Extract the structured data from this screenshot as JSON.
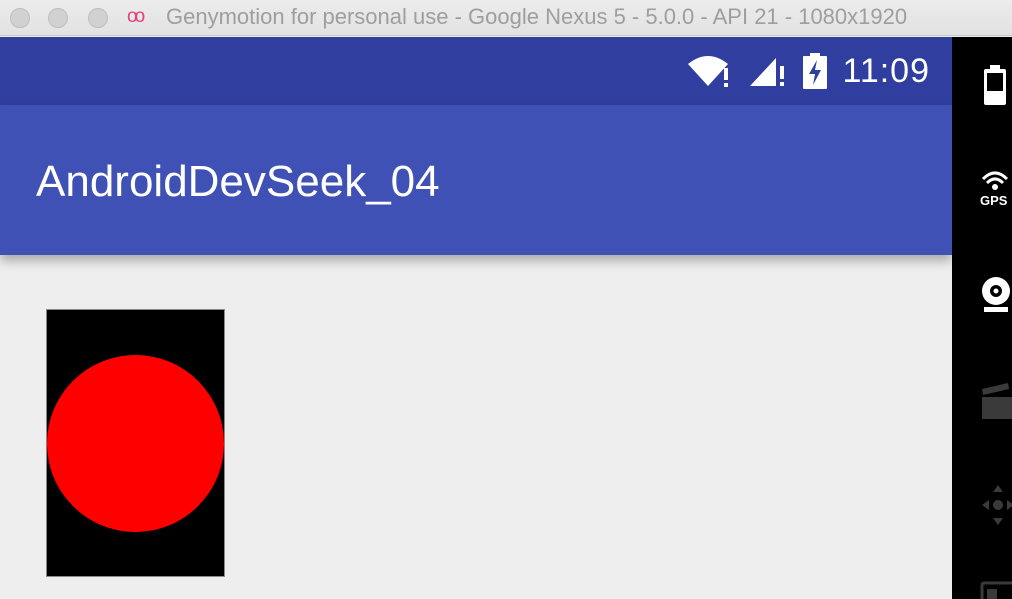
{
  "window": {
    "title": "Genymotion for personal use - Google Nexus 5 - 5.0.0 - API 21 - 1080x1920",
    "logo": "oo"
  },
  "statusbar": {
    "time": "11:09",
    "icons": [
      "wifi-icon",
      "signal-icon",
      "battery-charging-icon"
    ]
  },
  "appbar": {
    "title": "AndroidDevSeek_04"
  },
  "canvas": {
    "background_color": "#000000",
    "circle_color": "#ff0000"
  },
  "sidebar": {
    "items": [
      {
        "icon": "battery-icon"
      },
      {
        "icon": "gps-icon",
        "label": "GPS"
      },
      {
        "icon": "webcam-icon"
      },
      {
        "icon": "screencast-icon"
      },
      {
        "icon": "dpad-icon"
      },
      {
        "icon": "id-card-icon"
      }
    ]
  },
  "colors": {
    "status_bar": "#303f9f",
    "app_bar": "#3f51b5",
    "content_bg": "#eeeeee",
    "title_logo": "#e0427a"
  }
}
